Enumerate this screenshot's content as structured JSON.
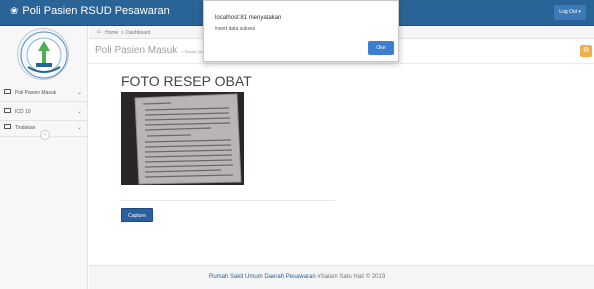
{
  "app": {
    "title": "Poli Pasien RSUD Pesawaran"
  },
  "topbar": {
    "logout_label": "Log Out"
  },
  "sidebar": {
    "logo_icon": "hospital-logo",
    "items": [
      {
        "label": "Poli Pasien Masuk",
        "icon": "monitor-icon"
      },
      {
        "label": "ICD 10",
        "icon": "monitor-icon"
      },
      {
        "label": "Tindakan",
        "icon": "monitor-icon"
      }
    ]
  },
  "breadcrumb": {
    "home": "Home",
    "separator": ">",
    "current": "Dashboard"
  },
  "page": {
    "title": "Poli Pasien Masuk",
    "subtitle": "> Resep Obat"
  },
  "main": {
    "photo_title": "FOTO RESEP OBAT",
    "capture_label": "Capture"
  },
  "footer": {
    "name": "Rumah Sakit Umum Daerah Pesawaran",
    "tagline": "#Salam Satu Hati © 2019"
  },
  "dialog": {
    "title": "localhost:81 menyatakan",
    "message": "insert data sukses",
    "ok_label": "Oke"
  },
  "colors": {
    "brand": "#2a6496",
    "primary": "#2a5fa0",
    "warning": "#f0ad4e",
    "dialog_button": "#3a7fd0"
  }
}
